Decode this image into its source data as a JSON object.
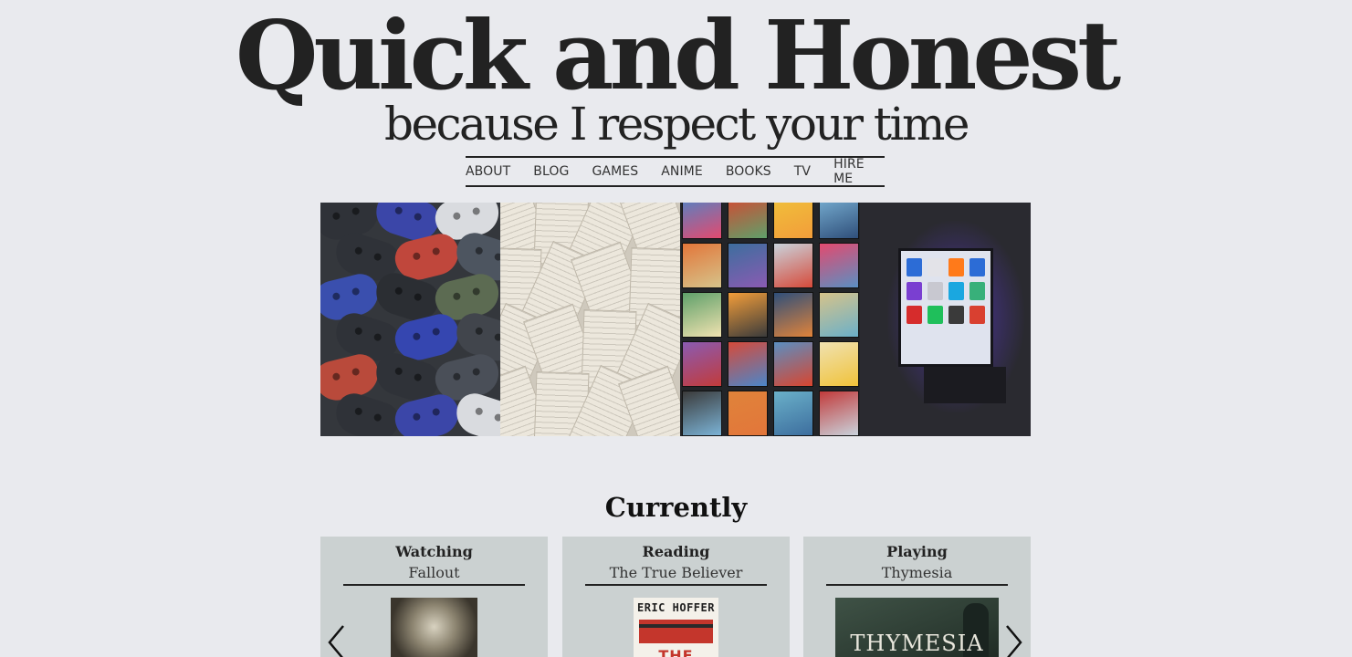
{
  "header": {
    "title": "Quick and Honest",
    "tagline": "because I respect your time"
  },
  "nav": {
    "items": [
      {
        "label": "ABOUT"
      },
      {
        "label": "BLOG"
      },
      {
        "label": "GAMES"
      },
      {
        "label": "ANIME"
      },
      {
        "label": "BOOKS"
      },
      {
        "label": "TV"
      },
      {
        "label": "HIRE ME"
      }
    ]
  },
  "hero": {
    "panels": [
      {
        "name": "games",
        "icon": "controllers-image"
      },
      {
        "name": "books",
        "icon": "open-books-image"
      },
      {
        "name": "anime",
        "icon": "anime-posters-image"
      },
      {
        "name": "tv",
        "icon": "television-image"
      }
    ]
  },
  "currently": {
    "heading": "Currently",
    "cards": [
      {
        "verb": "Watching",
        "title": "Fallout"
      },
      {
        "verb": "Reading",
        "title": "The True Believer",
        "cover_author": "ERIC HOFFER",
        "cover_title": "THE TRUE"
      },
      {
        "verb": "Playing",
        "title": "Thymesia",
        "cover_logo": "THYMESIA"
      }
    ]
  },
  "carousel": {
    "prev_icon": "chevron-left-icon",
    "next_icon": "chevron-right-icon"
  },
  "colors": {
    "background": "#e9eaee",
    "card": "#cbd1d1",
    "text": "#222222"
  }
}
